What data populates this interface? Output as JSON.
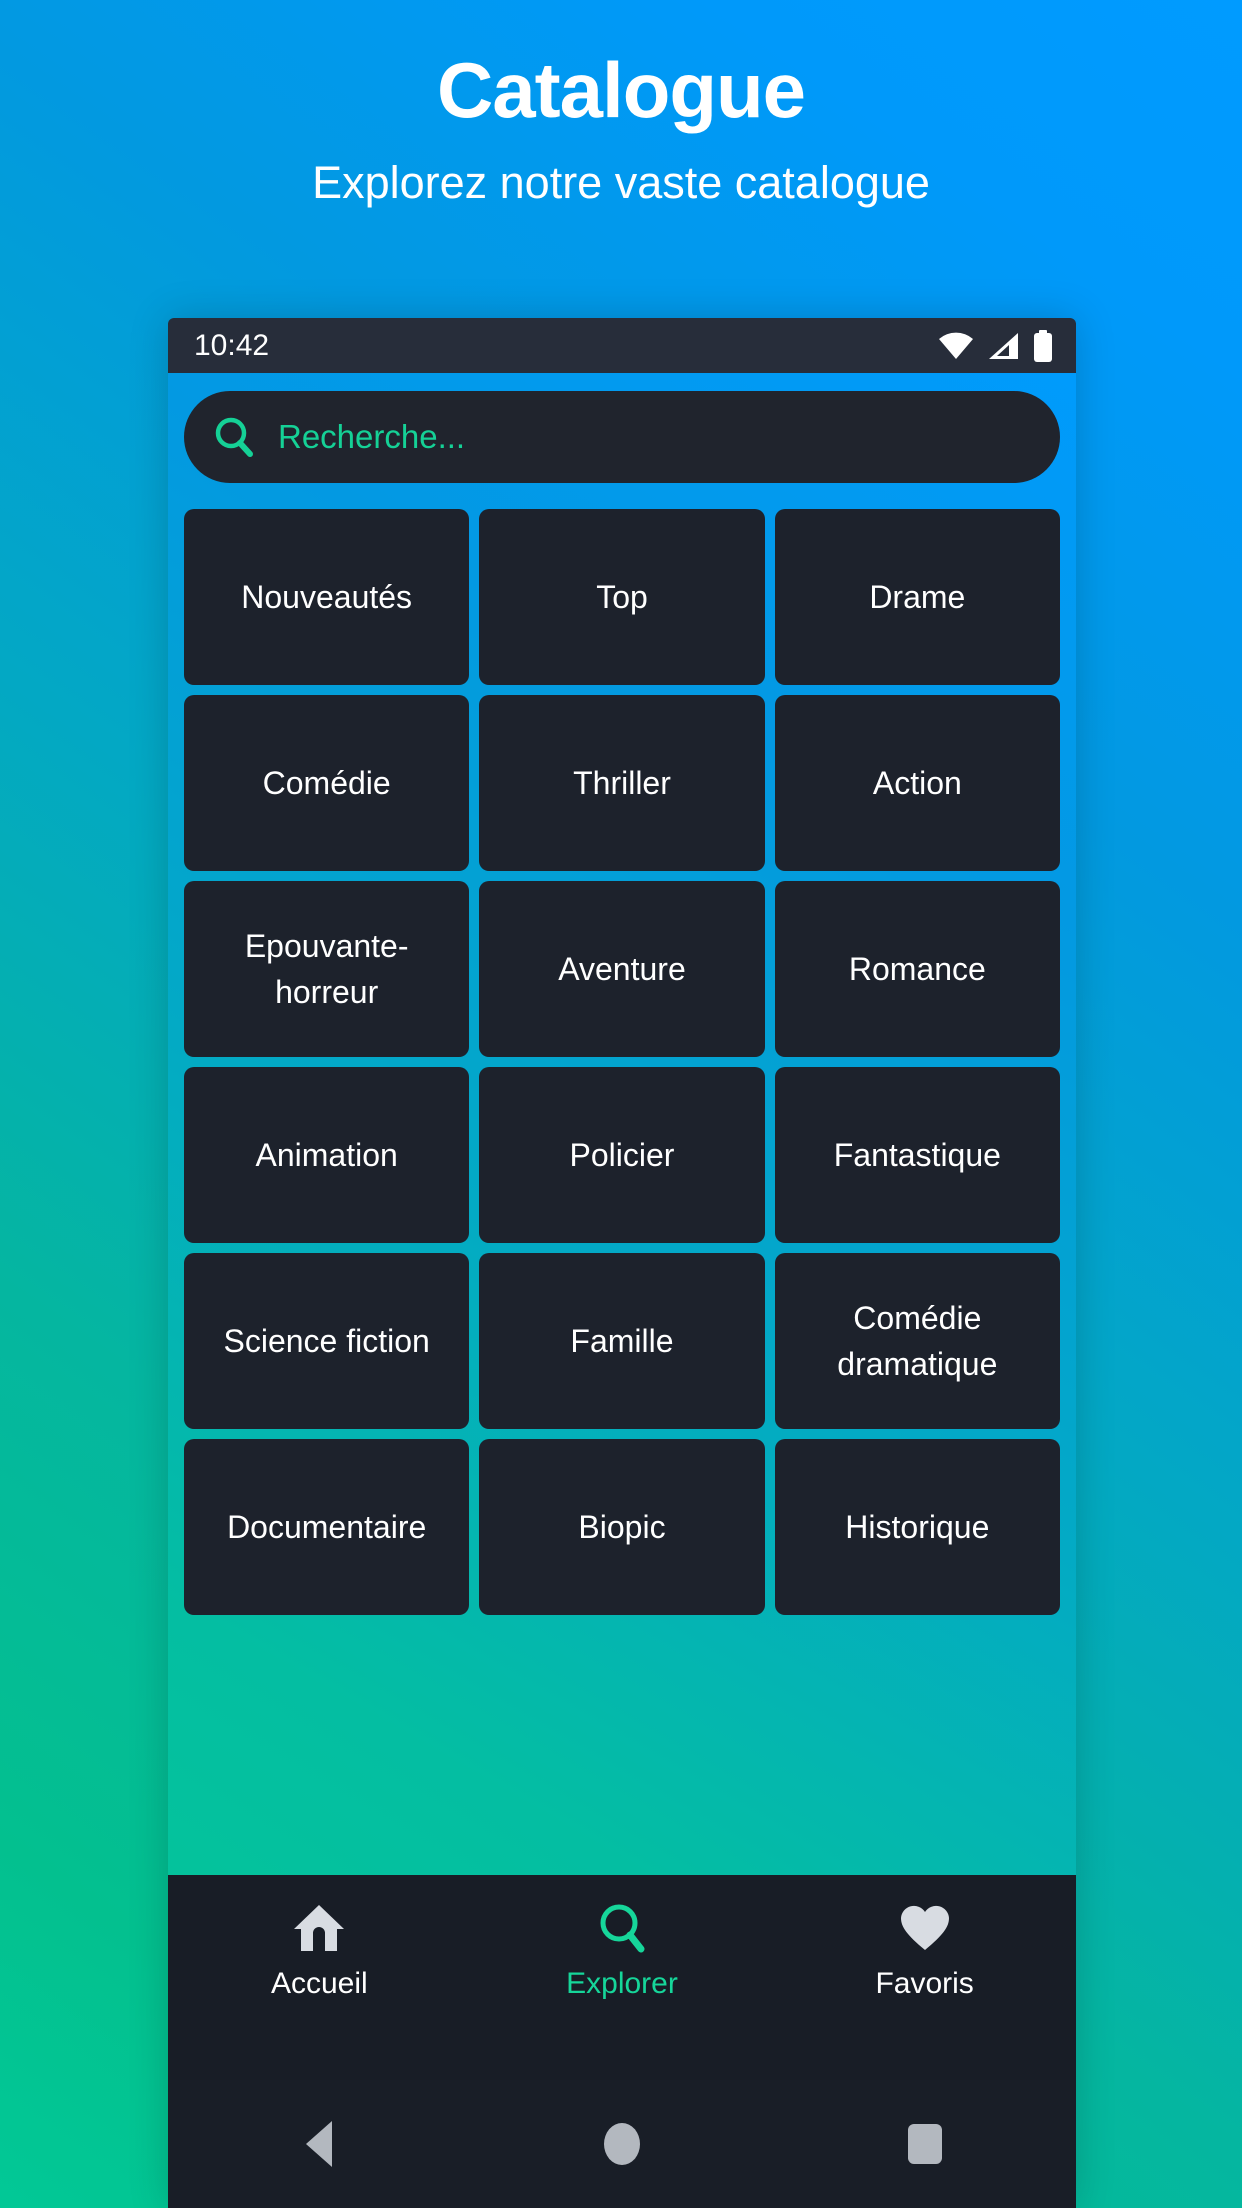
{
  "promo": {
    "title": "Catalogue",
    "subtitle": "Explorez notre vaste catalogue"
  },
  "status_bar": {
    "time": "10:42",
    "icons": [
      "wifi-icon",
      "cellular-signal-icon",
      "battery-icon"
    ]
  },
  "search": {
    "icon": "search-icon",
    "placeholder": "Recherche...",
    "value": ""
  },
  "grid": {
    "tiles": [
      {
        "label": "Nouveautés"
      },
      {
        "label": "Top"
      },
      {
        "label": "Drame"
      },
      {
        "label": "Comédie"
      },
      {
        "label": "Thriller"
      },
      {
        "label": "Action"
      },
      {
        "label": "Epouvante-horreur"
      },
      {
        "label": "Aventure"
      },
      {
        "label": "Romance"
      },
      {
        "label": "Animation"
      },
      {
        "label": "Policier"
      },
      {
        "label": "Fantastique"
      },
      {
        "label": "Science fiction"
      },
      {
        "label": "Famille"
      },
      {
        "label": "Comédie dramatique"
      },
      {
        "label": "Documentaire"
      },
      {
        "label": "Biopic"
      },
      {
        "label": "Historique"
      }
    ]
  },
  "bottom_nav": {
    "items": [
      {
        "label": "Accueil",
        "icon": "home-icon",
        "active": false
      },
      {
        "label": "Explorer",
        "icon": "search-icon",
        "active": true
      },
      {
        "label": "Favoris",
        "icon": "heart-icon",
        "active": false
      }
    ]
  },
  "system_nav": {
    "back": "back-triangle-icon",
    "home": "home-circle-icon",
    "recents": "recents-square-icon"
  },
  "colors": {
    "gradient_start": "#02c896",
    "gradient_end": "#0099ff",
    "accent_green": "#15d196",
    "tile_background": "#1d222c",
    "panel_background": "#20242d",
    "nav_background": "#181d26",
    "status_background": "#272d3a",
    "text_primary": "#ffffff",
    "icon_grey": "#b3b8bf"
  }
}
